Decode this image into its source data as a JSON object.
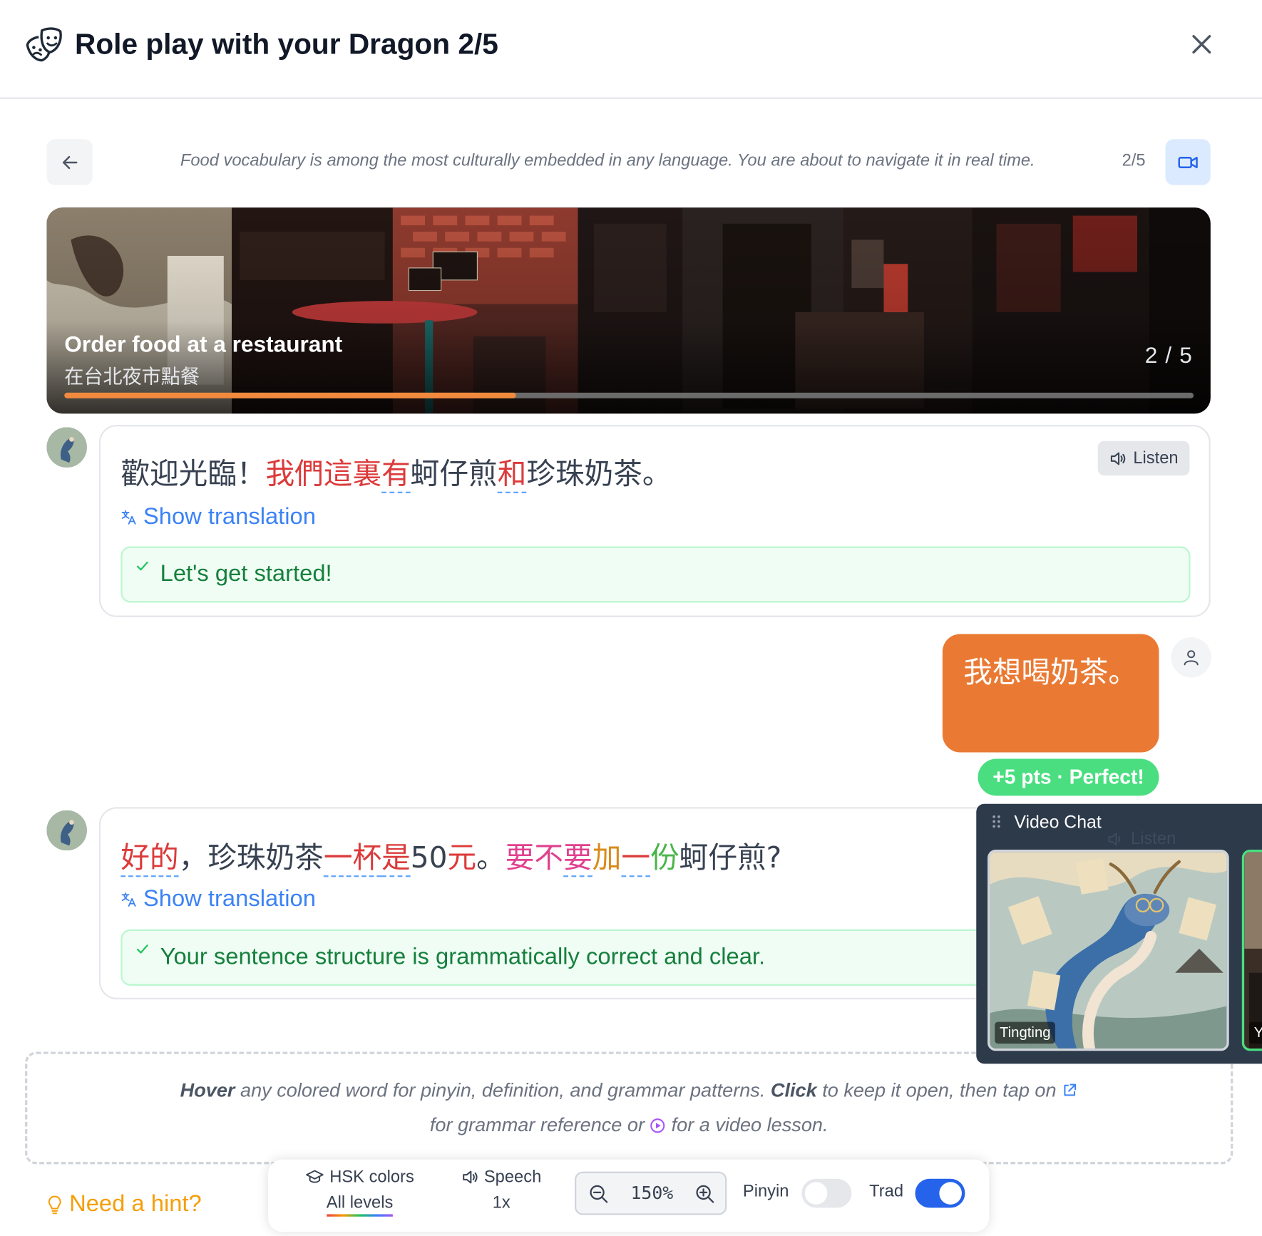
{
  "header": {
    "title": "Role play with your Dragon 2/5"
  },
  "scenario": {
    "intro": "Food vocabulary is among the most culturally embedded in any language. You are about to navigate it in real time.",
    "step_label": "2/5"
  },
  "banner": {
    "title": "Order food at a restaurant",
    "subtitle": "在台北夜市點餐",
    "step": "2 / 5",
    "progress": 0.4
  },
  "messages": [
    {
      "segments": [
        {
          "text": "歡迎光臨！",
          "color": "#374151",
          "underline": false
        },
        {
          "text": "我們",
          "color": "#dc3a3a",
          "underline": false
        },
        {
          "text": "這裏",
          "color": "#dc3a3a",
          "underline": false
        },
        {
          "text": "有",
          "color": "#dc3a3a",
          "underline": true
        },
        {
          "text": "蚵仔煎",
          "color": "#374151",
          "underline": false
        },
        {
          "text": "和",
          "color": "#dc3a3a",
          "underline": true
        },
        {
          "text": "珍珠奶茶。",
          "color": "#374151",
          "underline": false
        }
      ],
      "listen_label": "Listen",
      "show_translation": "Show translation",
      "feedback": "Let's get started!"
    },
    {
      "segments": [
        {
          "text": "好的",
          "color": "#dc3a3a",
          "underline": true
        },
        {
          "text": "，珍珠奶茶",
          "color": "#374151",
          "underline": false
        },
        {
          "text": "一杯",
          "color": "#dc3a3a",
          "underline": true
        },
        {
          "text": "是",
          "color": "#dc3a3a",
          "underline": true
        },
        {
          "text": "50",
          "color": "#374151",
          "underline": false
        },
        {
          "text": "元",
          "color": "#dc3a3a",
          "underline": false
        },
        {
          "text": "。",
          "color": "#374151",
          "underline": false
        },
        {
          "text": "要不",
          "color": "#e0418f",
          "underline": false
        },
        {
          "text": "要",
          "color": "#e0418f",
          "underline": true
        },
        {
          "text": "加",
          "color": "#d98b1c",
          "underline": false
        },
        {
          "text": "一",
          "color": "#dc3a3a",
          "underline": true
        },
        {
          "text": "份",
          "color": "#4ab54a",
          "underline": false
        },
        {
          "text": "蚵仔煎?",
          "color": "#374151",
          "underline": false
        }
      ],
      "show_translation": "Show translation",
      "feedback": "Your sentence structure is grammatically correct and clear."
    }
  ],
  "user_message": {
    "text": "我想喝奶茶。",
    "points": "+5 pts · Perfect!"
  },
  "info": {
    "hover_word": "Hover",
    "line1_a": " any colored word for pinyin, definition, and grammar patterns. ",
    "click_word": "Click",
    "line1_b": " to keep it open, then tap on ",
    "line2_a": "for grammar reference or ",
    "line2_b": " for a video lesson."
  },
  "hint": {
    "label": "Need a hint?"
  },
  "toolbar": {
    "hsk_label": "HSK colors",
    "hsk_value": "All levels",
    "speech_label": "Speech",
    "speech_value": "1x",
    "zoom_value": "150%",
    "pinyin_label": "Pinyin",
    "pinyin_on": false,
    "trad_label": "Trad",
    "trad_on": true
  },
  "video_chat": {
    "title": "Video Chat",
    "tile_name": "Tingting",
    "tile2_name": "Yo",
    "overlapped_listen": "Listen"
  },
  "colors": {
    "accent_orange": "#ea7a33",
    "link_blue": "#3b82f6",
    "success_green": "#15803d",
    "toggle_on": "#2563eb",
    "toggle_off": "#e5e7eb"
  }
}
